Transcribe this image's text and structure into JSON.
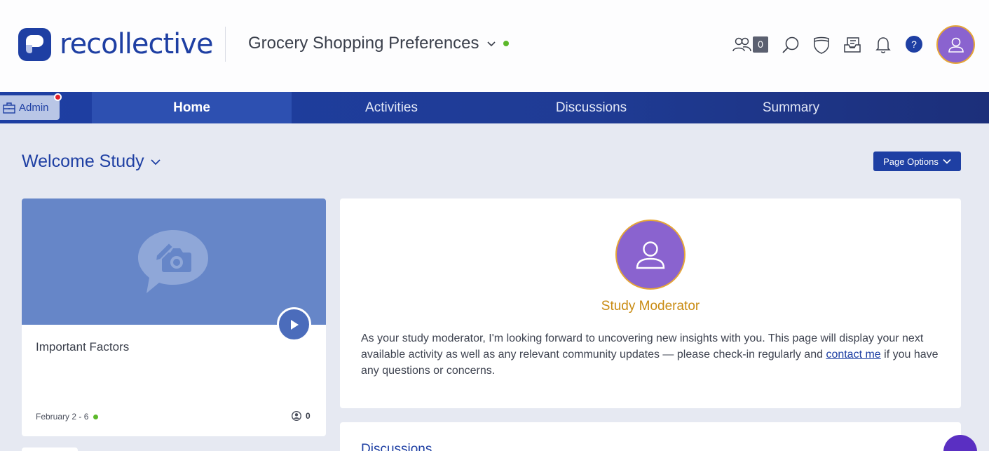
{
  "brand": {
    "name": "recollective"
  },
  "header": {
    "study_name": "Grocery Shopping Preferences",
    "participants_count": "0",
    "help_label": "?",
    "icons": [
      "participants-icon",
      "search-icon",
      "shield-icon",
      "inbox-icon",
      "bell-icon",
      "help-icon",
      "user-avatar-icon"
    ]
  },
  "admin": {
    "label": "Admin"
  },
  "nav": {
    "tabs": [
      {
        "label": "Home",
        "active": true
      },
      {
        "label": "Activities",
        "active": false
      },
      {
        "label": "Discussions",
        "active": false
      },
      {
        "label": "Summary",
        "active": false
      }
    ]
  },
  "page": {
    "title": "Welcome Study",
    "options_label": "Page Options"
  },
  "activity": {
    "title": "Important Factors",
    "dates": "February 2 - 6",
    "responses": "0"
  },
  "moderator": {
    "name": "Study Moderator",
    "text_before": "As your study moderator, I'm looking forward to uncovering new insights with you. This page will display your next available activity as well as any relevant community updates — please check-in regularly and ",
    "link": "contact me",
    "text_after": " if you have any questions or concerns."
  },
  "discussions": {
    "title": "Discussions"
  },
  "colors": {
    "brand_blue": "#1e3fa3",
    "avatar_purple": "#8a63cf",
    "moderator_gold": "#c98b12",
    "status_green": "#5cb82a"
  }
}
